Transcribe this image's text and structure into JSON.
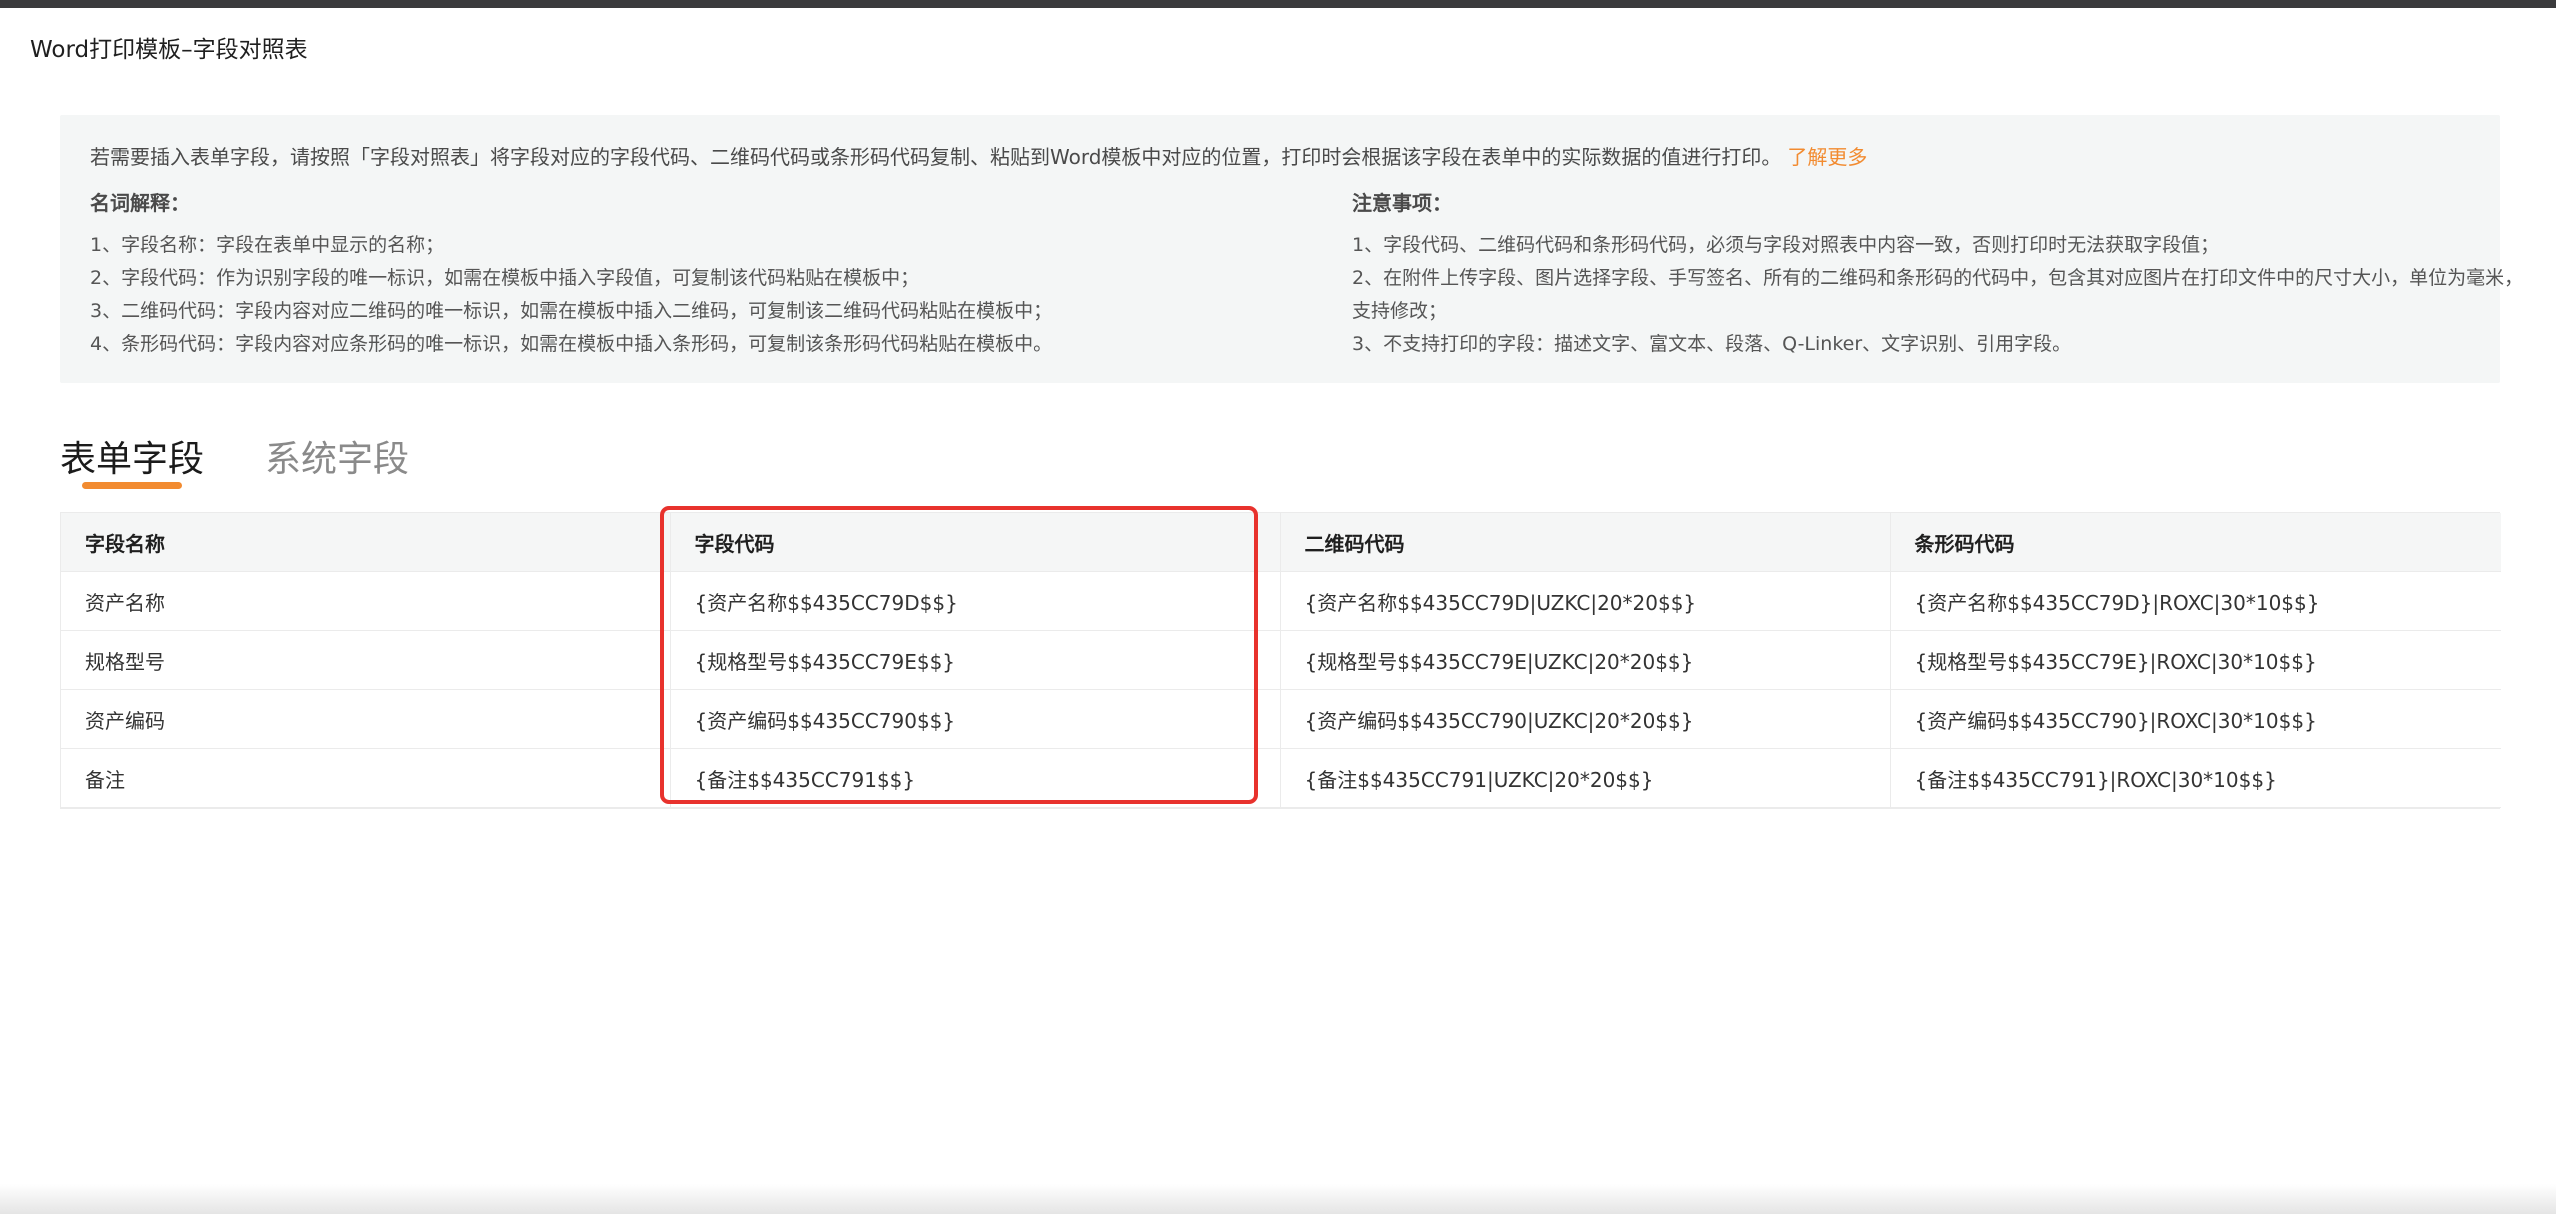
{
  "page": {
    "title": "Word打印模板–字段对照表"
  },
  "info": {
    "intro": "若需要插入表单字段，请按照「字段对照表」将字段对应的字段代码、二维码代码或条形码代码复制、粘贴到Word模板中对应的位置，打印时会根据该字段在表单中的实际数据的值进行打印。",
    "learn_more": "了解更多",
    "glossary": {
      "heading": "名词解释：",
      "lines": [
        "1、字段名称：字段在表单中显示的名称；",
        "2、字段代码：作为识别字段的唯一标识，如需在模板中插入字段值，可复制该代码粘贴在模板中；",
        "3、二维码代码：字段内容对应二维码的唯一标识，如需在模板中插入二维码，可复制该二维码代码粘贴在模板中；",
        "4、条形码代码：字段内容对应条形码的唯一标识，如需在模板中插入条形码，可复制该条形码代码粘贴在模板中。"
      ]
    },
    "notes": {
      "heading": "注意事项：",
      "lines": [
        "1、字段代码、二维码代码和条形码代码，必须与字段对照表中内容一致，否则打印时无法获取字段值；",
        "2、在附件上传字段、图片选择字段、手写签名、所有的二维码和条形码的代码中，包含其对应图片在打印文件中的尺寸大小，单位为毫米，支持修改；",
        "3、不支持打印的字段：描述文字、富文本、段落、Q-Linker、文字识别、引用字段。"
      ]
    }
  },
  "tabs": {
    "form_fields": "表单字段",
    "system_fields": "系统字段",
    "active": "form_fields",
    "accent_color": "#f28b30"
  },
  "table": {
    "headers": {
      "name": "字段名称",
      "code": "字段代码",
      "qrcode": "二维码代码",
      "barcode": "条形码代码"
    },
    "rows": [
      {
        "name": "资产名称",
        "code": "{资产名称$$435CC79D$$}",
        "qrcode": "{资产名称$$435CC79D|UZKC|20*20$$}",
        "barcode": "{资产名称$$435CC79D}|ROXC|30*10$$}"
      },
      {
        "name": "规格型号",
        "code": "{规格型号$$435CC79E$$}",
        "qrcode": "{规格型号$$435CC79E|UZKC|20*20$$}",
        "barcode": "{规格型号$$435CC79E}|ROXC|30*10$$}"
      },
      {
        "name": "资产编码",
        "code": "{资产编码$$435CC790$$}",
        "qrcode": "{资产编码$$435CC790|UZKC|20*20$$}",
        "barcode": "{资产编码$$435CC790}|ROXC|30*10$$}"
      },
      {
        "name": "备注",
        "code": "{备注$$435CC791$$}",
        "qrcode": "{备注$$435CC791|UZKC|20*20$$}",
        "barcode": "{备注$$435CC791}|ROXC|30*10$$}"
      }
    ],
    "highlight_color": "#e8322d"
  }
}
